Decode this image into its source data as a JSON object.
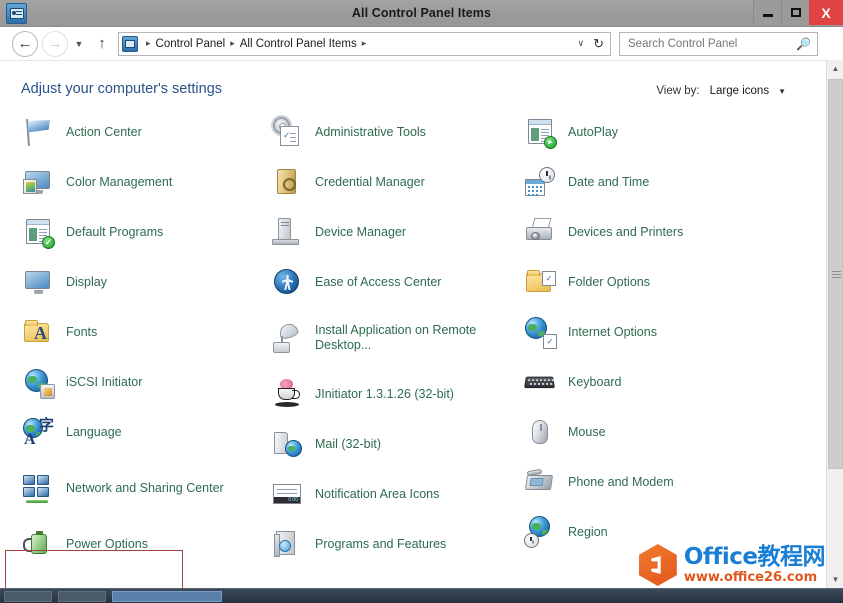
{
  "window": {
    "title": "All Control Panel Items",
    "app_icon": "control-panel-icon",
    "controls": {
      "minimize": "–",
      "maximize": "□",
      "close": "X"
    }
  },
  "navbar": {
    "back": "←",
    "forward": "→",
    "history_caret": "▼",
    "up": "↑",
    "breadcrumb_icon": "control-panel-icon",
    "breadcrumbs": [
      "Control Panel",
      "All Control Panel Items"
    ],
    "separator": "▸",
    "dropdown_caret": "∨",
    "refresh": "↻",
    "search": {
      "placeholder": "Search Control Panel",
      "value": "",
      "icon": "search-icon"
    }
  },
  "header": {
    "page_title": "Adjust your computer's settings",
    "view_by_label": "View by:",
    "view_by_value": "Large icons",
    "view_by_caret": "▼"
  },
  "highlight": {
    "target": "Language",
    "color": "#a14444"
  },
  "columns": [
    {
      "items": [
        {
          "label": "Action Center",
          "icon": "flag-icon"
        },
        {
          "label": "Color Management",
          "icon": "color-management-icon"
        },
        {
          "label": "Default Programs",
          "icon": "default-programs-icon"
        },
        {
          "label": "Display",
          "icon": "display-icon"
        },
        {
          "label": "Fonts",
          "icon": "fonts-icon"
        },
        {
          "label": "iSCSI Initiator",
          "icon": "iscsi-initiator-icon"
        },
        {
          "label": "Language",
          "icon": "language-icon"
        },
        {
          "label": "Network and Sharing Center",
          "icon": "network-sharing-icon",
          "two_line": true
        },
        {
          "label": "Power Options",
          "icon": "power-options-icon"
        }
      ]
    },
    {
      "items": [
        {
          "label": "Administrative Tools",
          "icon": "administrative-tools-icon"
        },
        {
          "label": "Credential Manager",
          "icon": "credential-manager-icon"
        },
        {
          "label": "Device Manager",
          "icon": "device-manager-icon"
        },
        {
          "label": "Ease of Access Center",
          "icon": "ease-of-access-icon"
        },
        {
          "label": "Install Application on Remote Desktop...",
          "icon": "install-application-icon",
          "two_line": true
        },
        {
          "label": "JInitiator 1.3.1.26 (32-bit)",
          "icon": "jinitiator-icon"
        },
        {
          "label": "Mail (32-bit)",
          "icon": "mail-icon"
        },
        {
          "label": "Notification Area Icons",
          "icon": "notification-area-icon"
        },
        {
          "label": "Programs and Features",
          "icon": "programs-features-icon"
        }
      ]
    },
    {
      "items": [
        {
          "label": "AutoPlay",
          "icon": "autoplay-icon"
        },
        {
          "label": "Date and Time",
          "icon": "date-time-icon"
        },
        {
          "label": "Devices and Printers",
          "icon": "devices-printers-icon"
        },
        {
          "label": "Folder Options",
          "icon": "folder-options-icon"
        },
        {
          "label": "Internet Options",
          "icon": "internet-options-icon"
        },
        {
          "label": "Keyboard",
          "icon": "keyboard-icon"
        },
        {
          "label": "Mouse",
          "icon": "mouse-icon"
        },
        {
          "label": "Phone and Modem",
          "icon": "phone-modem-icon"
        },
        {
          "label": "Region",
          "icon": "region-icon"
        }
      ]
    }
  ],
  "scrollbar": {
    "up_arrow": "▲",
    "down_arrow": "▼"
  },
  "watermark": {
    "line1": "Office教程网",
    "line2": "www.office26.com"
  }
}
